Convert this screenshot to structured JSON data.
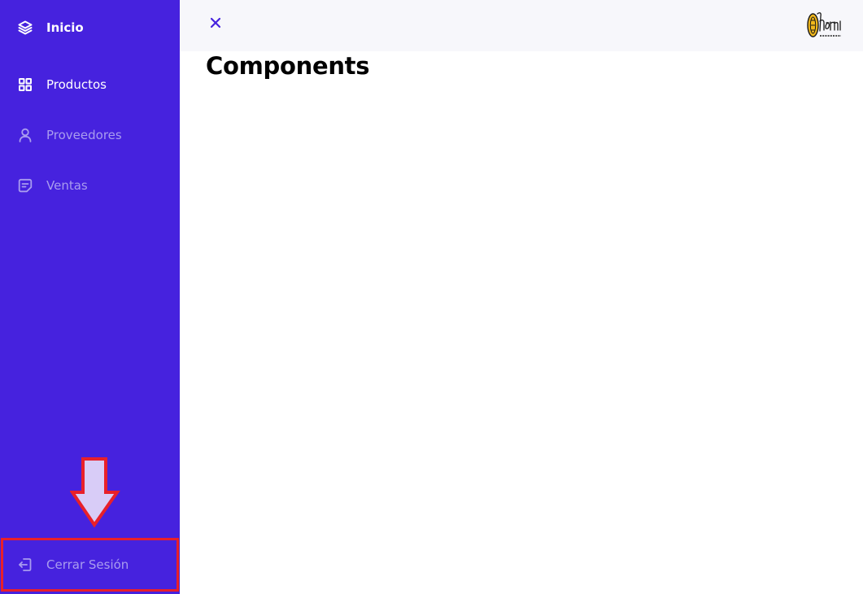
{
  "colors": {
    "sidebar_bg": "#4622DE",
    "nav_active_text": "#FFFFFF",
    "nav_muted_text": "#A99CEF",
    "topbar_bg": "#F7F7FB",
    "close_icon": "#4622DE",
    "highlight_red": "#E8202A",
    "arrow_fill": "#D8CCF7"
  },
  "sidebar": {
    "brand": {
      "label": "Inicio",
      "icon": "layers-icon"
    },
    "items": [
      {
        "label": "Productos",
        "icon": "grid-icon",
        "active": true
      },
      {
        "label": "Proveedores",
        "icon": "user-icon",
        "active": false
      },
      {
        "label": "Ventas",
        "icon": "note-icon",
        "active": false
      }
    ],
    "logout": {
      "label": "Cerrar Sesión",
      "icon": "logout-icon"
    }
  },
  "header": {
    "close_icon": "close-icon",
    "logo_icon": "hornito-logo-icon"
  },
  "main": {
    "title": "Components"
  }
}
